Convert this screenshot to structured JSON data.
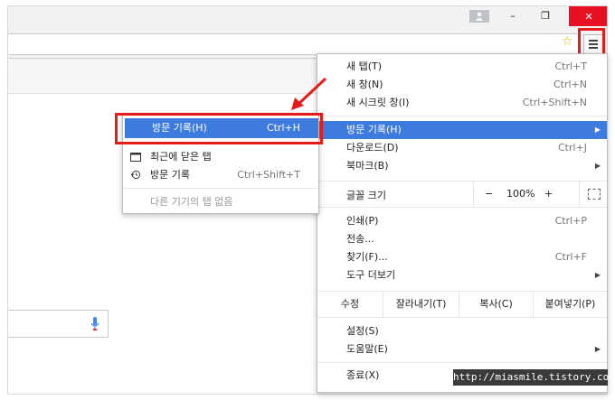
{
  "titlebar": {
    "close_glyph": "✕",
    "minimize_glyph": "–",
    "maximize_glyph": "❐",
    "star_glyph": "☆"
  },
  "main_menu": {
    "items": [
      {
        "label": "새 탭(T)",
        "shortcut": "Ctrl+T"
      },
      {
        "label": "새 창(N)",
        "shortcut": "Ctrl+N"
      },
      {
        "label": "새 시크릿 창(I)",
        "shortcut": "Ctrl+Shift+N"
      },
      {
        "label": "방문 기록(H)",
        "shortcut": ""
      },
      {
        "label": "다운로드(D)",
        "shortcut": "Ctrl+J"
      },
      {
        "label": "북마크(B)",
        "shortcut": ""
      },
      {
        "label": "인쇄(P)",
        "shortcut": "Ctrl+P"
      },
      {
        "label": "전송...",
        "shortcut": ""
      },
      {
        "label": "찾기(F)...",
        "shortcut": "Ctrl+F"
      },
      {
        "label": "도구 더보기",
        "shortcut": ""
      },
      {
        "label": "설정(S)",
        "shortcut": ""
      },
      {
        "label": "도움말(E)",
        "shortcut": ""
      },
      {
        "label": "종료(X)",
        "shortcut": ""
      }
    ],
    "zoom": {
      "label": "글꼴 크기",
      "minus": "−",
      "value": "100%",
      "plus": "+"
    },
    "edit": {
      "label": "수정",
      "cut": "잘라내기(T)",
      "copy": "복사(C)",
      "paste": "붙여넣기(P)"
    }
  },
  "history_submenu": {
    "history": {
      "label": "방문 기록(H)",
      "shortcut": "Ctrl+H"
    },
    "recently_closed": {
      "label": "최근에 닫은 탭"
    },
    "history_entry": {
      "label": "방문 기록",
      "shortcut": "Ctrl+Shift+T"
    },
    "no_tabs": {
      "label": "다른 기기의 탭 없음"
    }
  },
  "colors": {
    "highlight": "#3d7bde",
    "annotation_red": "#e81b1b",
    "close_red": "#e81123"
  },
  "watermark": "http://miasmile.tistory.com"
}
